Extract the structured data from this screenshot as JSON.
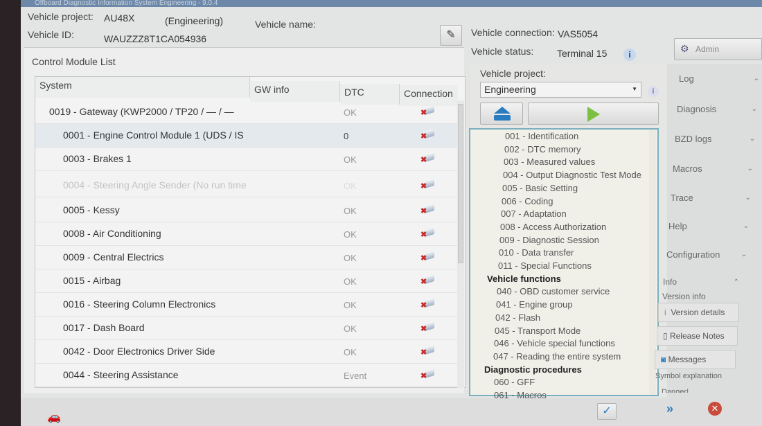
{
  "window": {
    "title": "Offboard Diagnostic Information System Engineering - 9.0.4"
  },
  "header": {
    "vehicle_project_label": "Vehicle project:",
    "vehicle_project": "AU48X",
    "project_type": "(Engineering)",
    "vehicle_name_label": "Vehicle name:",
    "vehicle_id_label": "Vehicle ID:",
    "vehicle_id": "WAUZZZ8T1CA054936",
    "connection_label": "Vehicle connection:",
    "connection": "VAS5054",
    "status_label": "Vehicle status:",
    "status": "Terminal 15"
  },
  "module_list": {
    "title": "Control Module List",
    "columns": [
      "System",
      "GW info",
      "DTC",
      "Connection"
    ],
    "rows": [
      {
        "system": "0019 - Gateway  (KWP2000 / TP20 / — / — / —",
        "dtc": "OK"
      },
      {
        "system": "0001 - Engine Control Module 1  (UDS / IS",
        "dtc": "0"
      },
      {
        "system": "0003 - Brakes 1",
        "dtc": "OK"
      },
      {
        "system": "0004 - Steering Angle Sender  (No run time",
        "dtc": "OK"
      },
      {
        "system": "0005 - Kessy",
        "dtc": "OK"
      },
      {
        "system": "0008 - Air Conditioning",
        "dtc": "OK"
      },
      {
        "system": "0009 - Central Electrics",
        "dtc": "OK"
      },
      {
        "system": "0015 - Airbag",
        "dtc": "OK"
      },
      {
        "system": "0016 - Steering Column Electronics",
        "dtc": "OK"
      },
      {
        "system": "0017 - Dash Board",
        "dtc": "OK"
      },
      {
        "system": "0042 - Door Electronics Driver Side",
        "dtc": "OK"
      },
      {
        "system": "0044 - Steering Assistance",
        "dtc": "Event"
      }
    ]
  },
  "right_panel": {
    "vehicle_project_label": "Vehicle project:",
    "dropdown_value": "Engineering",
    "tree": {
      "items": [
        "001 - Identification",
        "002 - DTC memory",
        "003 - Measured values",
        "004 - Output Diagnostic Test Mode",
        "005 - Basic Setting",
        "006 - Coding",
        "007 - Adaptation",
        "008 - Access Authorization",
        "009 - Diagnostic Session",
        "010 - Data transfer",
        "011 - Special Functions"
      ],
      "group_vehicle": "Vehicle functions",
      "vehicle_items": [
        "040 - OBD customer service",
        "041 - Engine group",
        "042 - Flash",
        "045 - Transport Mode",
        "046 - Vehicle special functions",
        "047 - Reading the entire system"
      ],
      "group_diag": "Diagnostic procedures",
      "diag_items": [
        "060 - GFF",
        "061 - Macros"
      ]
    }
  },
  "sidebar": {
    "admin": "Admin",
    "items": [
      "Log",
      "Diagnosis",
      "BZD logs",
      "Macros",
      "Trace",
      "Help",
      "Configuration"
    ],
    "info": "Info",
    "version_info": "Version info",
    "version_details": "Version details",
    "release_notes": "Release Notes",
    "messages": "Messages",
    "symbol_explanation": "Symbol explanation",
    "danger": "Danger!"
  },
  "colors": {
    "accent": "#7ab0c0",
    "error": "#c62a2a",
    "play": "#7cc043",
    "eject": "#2a7cc0"
  }
}
